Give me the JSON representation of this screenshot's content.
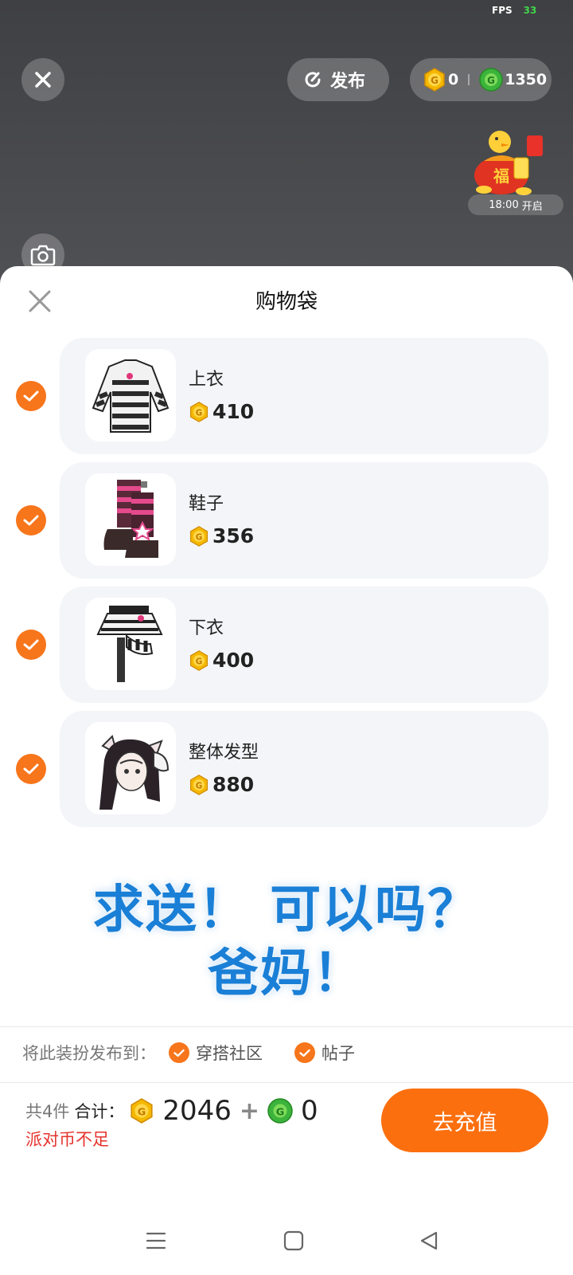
{
  "status": {
    "fps_label": "FPS",
    "fps_value": "33"
  },
  "header": {
    "publish_label": "发布",
    "gold_balance": "0",
    "green_balance": "1350"
  },
  "event": {
    "time_label": "18:00",
    "status_label": "开启"
  },
  "sheet": {
    "title": "购物袋",
    "items": [
      {
        "name": "上衣",
        "price": "410",
        "checked": true
      },
      {
        "name": "鞋子",
        "price": "356",
        "checked": true
      },
      {
        "name": "下衣",
        "price": "400",
        "checked": true
      },
      {
        "name": "整体发型",
        "price": "880",
        "checked": true
      }
    ],
    "overlay_text_line1": "求送！ 可以吗？",
    "overlay_text_line2": "爸妈！",
    "publish_to_label": "将此装扮发布到：",
    "publish_options": [
      {
        "label": "穿搭社区",
        "checked": true
      },
      {
        "label": "帖子",
        "checked": true
      }
    ],
    "count_label": "共4件",
    "total_label": "合计：",
    "gold_total": "2046",
    "plus": "+",
    "green_total": "0",
    "warning": "派对币不足",
    "recharge_label": "去充值"
  },
  "colors": {
    "accent": "#f7751b",
    "warning": "#e5322d",
    "overlay_text": "#1a7fd6",
    "gold_coin": "#f5b800",
    "green_coin": "#3cb43c"
  },
  "icons": [
    "close-icon",
    "refresh-publish-icon",
    "gold-coin-icon",
    "green-coin-icon",
    "camera-icon",
    "check-icon",
    "menu-icon",
    "home-square-icon",
    "back-triangle-icon"
  ]
}
